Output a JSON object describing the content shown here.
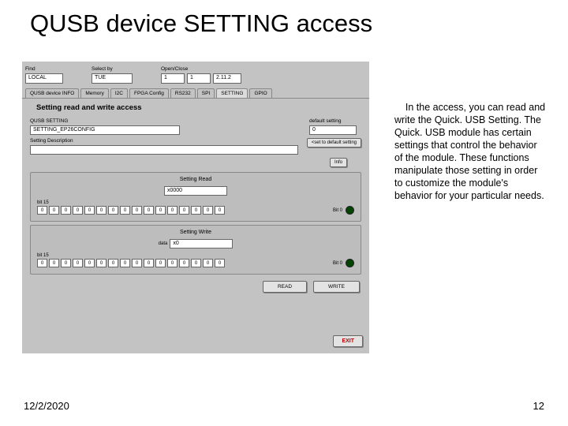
{
  "slide": {
    "title": "QUSB device SETTING access",
    "date": "12/2/2020",
    "page": "12"
  },
  "topbar": {
    "findLabel": "Find",
    "findValue": "LOCAL",
    "selectLabel": "Select by",
    "selectValue": "TUE",
    "openLabel": "Open/Close",
    "openA": "1",
    "openB": "1",
    "openC": "2.11.2"
  },
  "tabs": [
    "QUSB device INFO",
    "Memory",
    "I2C",
    "FPGA Config",
    "RS232",
    "SPI",
    "SETTING",
    "GPIO"
  ],
  "section": {
    "heading": "Setting read and write access",
    "qusbSettingLabel": "QUSB SETTING",
    "qusbSettingValue": "SETTING_EP26CONFIG",
    "defaultSettingLabel": "default setting",
    "defaultSettingValue": "0",
    "setDefaultBtn": "<set to default setting",
    "settingDescLabel": "Setting Description",
    "settingDescValue": "",
    "infoBtn": "Info"
  },
  "readPanel": {
    "title": "Setting Read",
    "dataValue": "x0000",
    "bit15": "bit 15",
    "bit0": "Bit 0",
    "bits": [
      "0",
      "0",
      "0",
      "0",
      "0",
      "0",
      "0",
      "0",
      "0",
      "0",
      "0",
      "0",
      "0",
      "0",
      "0",
      "0"
    ]
  },
  "writePanel": {
    "title": "Setting Write",
    "dataLabel": "data",
    "dataValue": "x0",
    "bit15": "bit 15",
    "bit0": "Bit 0",
    "bits": [
      "0",
      "0",
      "0",
      "0",
      "0",
      "0",
      "0",
      "0",
      "0",
      "0",
      "0",
      "0",
      "0",
      "0",
      "0",
      "0"
    ]
  },
  "buttons": {
    "read": "READ",
    "write": "WRITE",
    "exit": "EXIT"
  },
  "description": "    In the access, you can read and write the Quick. USB Setting. The Quick. USB module has certain settings that control the behavior of the module. These functions manipulate those setting in order to customize the module's behavior for your particular needs."
}
